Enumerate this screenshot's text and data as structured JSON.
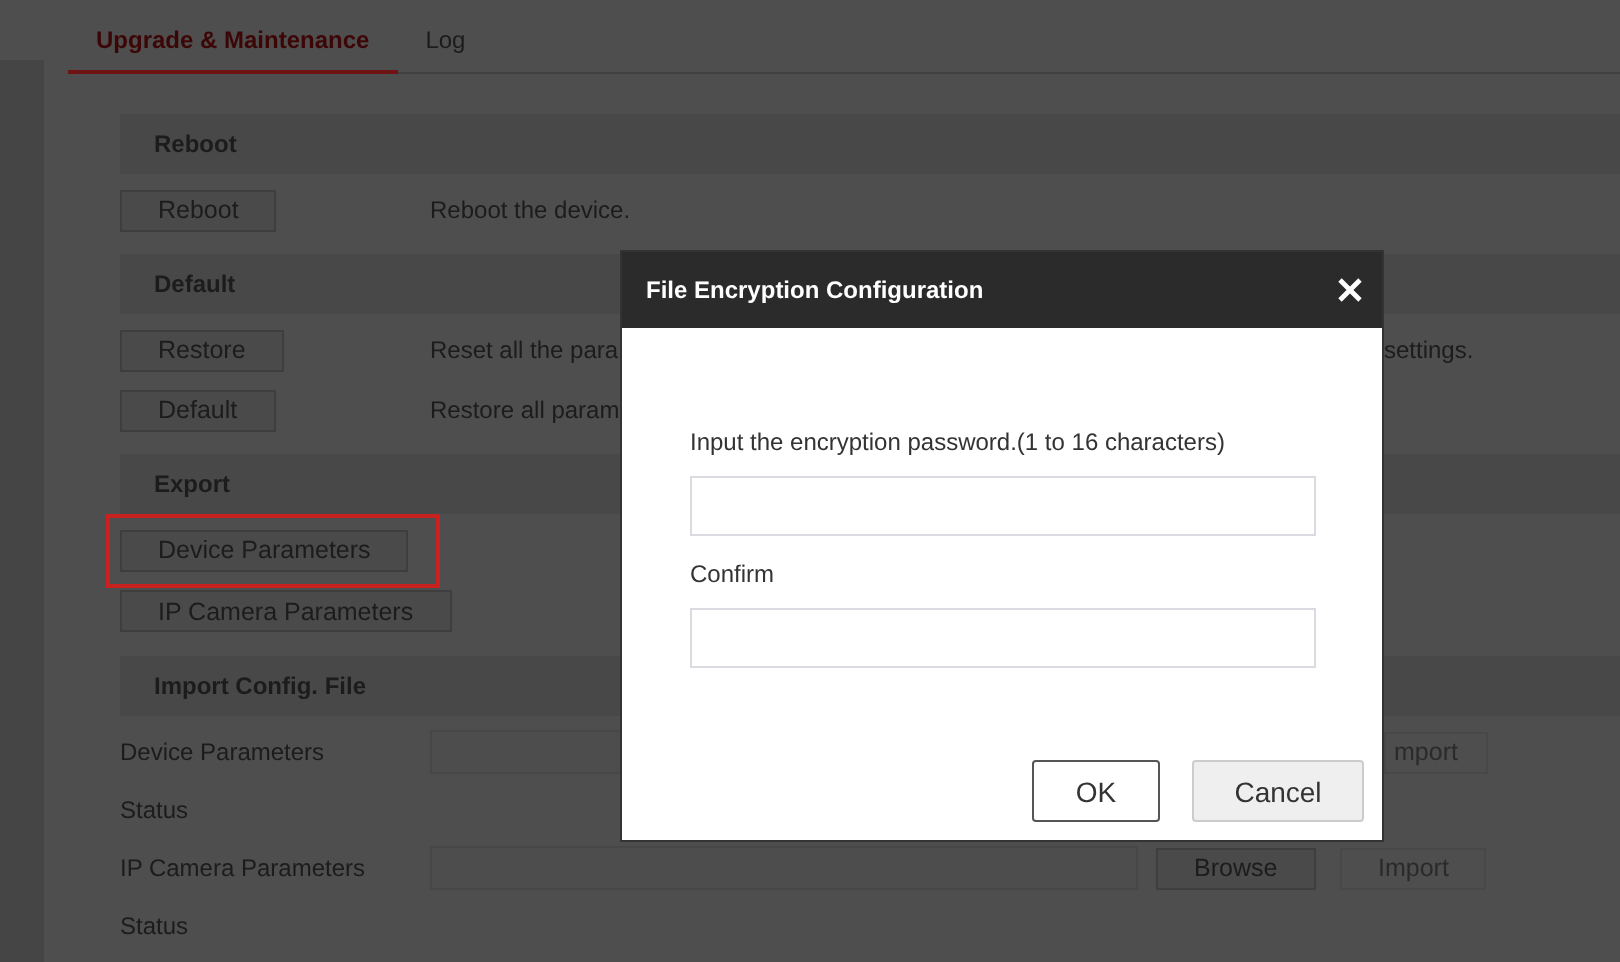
{
  "tabs": [
    {
      "label": "Upgrade & Maintenance",
      "selected": true
    },
    {
      "label": "Log",
      "selected": false
    }
  ],
  "sections": [
    {
      "title": "Reboot",
      "rows": [
        {
          "kind": "action",
          "button": "Reboot",
          "description": "Reboot the device."
        }
      ]
    },
    {
      "title": "Default",
      "rows": [
        {
          "kind": "action",
          "button": "Restore",
          "description": "Reset all the para",
          "trailing": "settings."
        },
        {
          "kind": "action",
          "button": "Default",
          "description": "Restore all param"
        }
      ]
    },
    {
      "title": "Export",
      "rows": [
        {
          "kind": "export",
          "button": "Device Parameters",
          "highlighted": true
        },
        {
          "kind": "export",
          "button": "IP Camera Parameters",
          "highlighted": false
        }
      ]
    },
    {
      "title": "Import Config. File",
      "rows": [
        {
          "kind": "file",
          "label": "Device Parameters",
          "import": "mport",
          "import_disabled": true
        },
        {
          "kind": "status",
          "label": "Status"
        },
        {
          "kind": "file",
          "label": "IP Camera Parameters",
          "browse": "Browse",
          "import": "Import",
          "import_disabled": true
        },
        {
          "kind": "status",
          "label": "Status"
        }
      ]
    }
  ],
  "dialog": {
    "title": "File Encryption Configuration",
    "fields": [
      {
        "label": "Input the encryption password.(1 to 16 characters)"
      },
      {
        "label": "Confirm"
      }
    ],
    "buttons": [
      {
        "label": "OK",
        "kind": "primary"
      },
      {
        "label": "Cancel",
        "kind": "secondary"
      }
    ]
  }
}
